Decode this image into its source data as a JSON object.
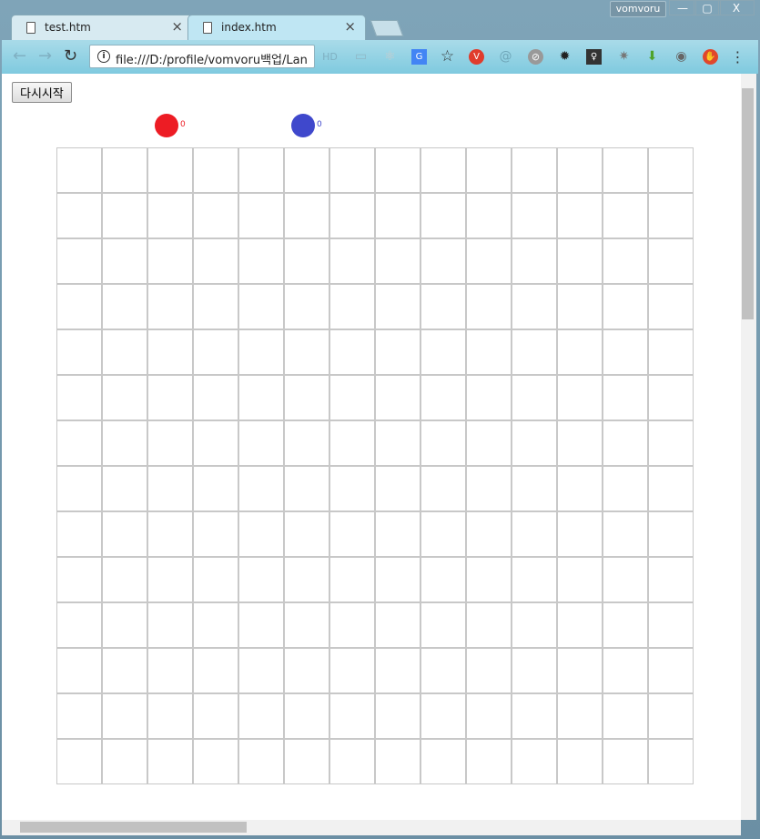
{
  "browser": {
    "tabs": [
      {
        "label": "test.htm",
        "active": false
      },
      {
        "label": "index.htm",
        "active": true
      }
    ],
    "user": "vomvoru",
    "window_buttons": [
      "—",
      "▢",
      "X"
    ],
    "url": "file:///D:/profile/vomvoru백업/Lan",
    "extension_icons": [
      "hd-icon",
      "page-icon",
      "react-icon",
      "translate-icon",
      "star-icon",
      "vivaldi-icon",
      "at-icon",
      "compass-icon",
      "gear-icon",
      "bulb-icon",
      "puzzle-icon",
      "download-icon",
      "camera-icon",
      "stop-icon",
      "menu-icon"
    ]
  },
  "game": {
    "restart_label": "다시시작",
    "players": [
      {
        "color": "#ed1c24",
        "score": "0"
      },
      {
        "color": "#3f48cc",
        "score": "0"
      }
    ],
    "grid": {
      "rows": 14,
      "cols": 14,
      "line_color": "#c8c8c8"
    }
  }
}
